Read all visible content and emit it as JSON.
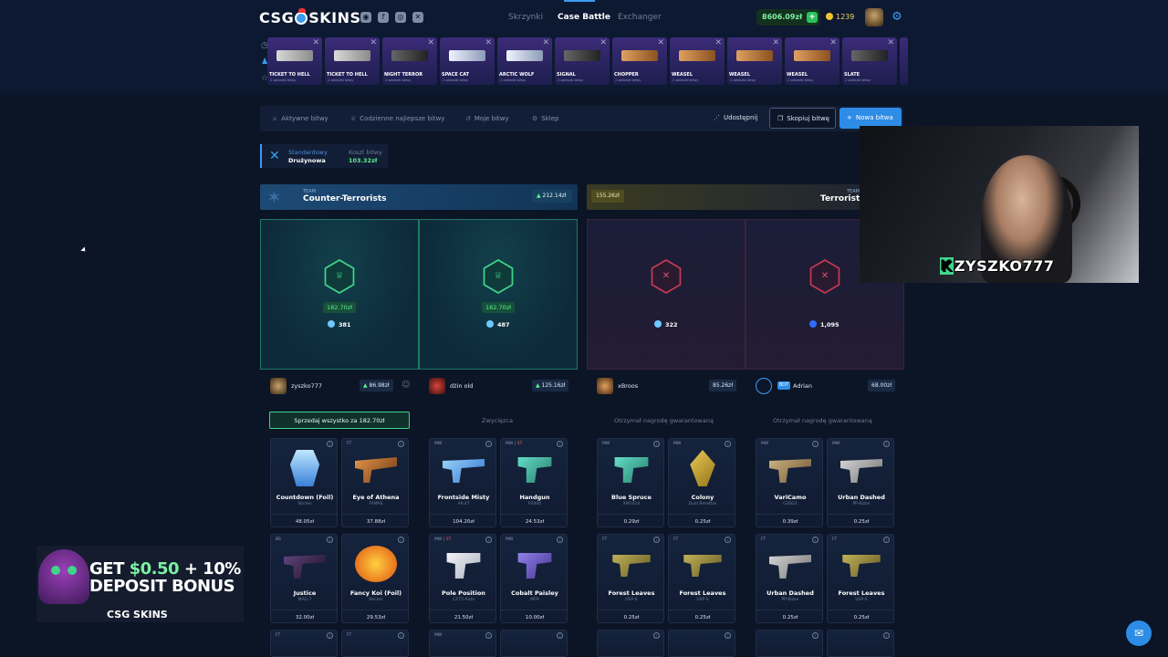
{
  "header": {
    "logo": "CSG",
    "logo_suffix": "SKINS",
    "nav": [
      "Skrzynki",
      "Case Battle",
      "Exchanger"
    ],
    "balance": "8606.09zł",
    "coins": "1239"
  },
  "drops": [
    {
      "name": "TICKET TO HELL",
      "sub": "2 zakładki bitwy"
    },
    {
      "name": "TICKET TO HELL",
      "sub": "2 zakładki bitwy"
    },
    {
      "name": "NIGHT TERROR",
      "sub": "2 zakładki bitwy"
    },
    {
      "name": "SPACE CAT",
      "sub": "2 zakładki bitwy"
    },
    {
      "name": "ARCTIC WOLF",
      "sub": "2 zakładki bitwy"
    },
    {
      "name": "SIGNAL",
      "sub": "2 zakładki bitwy"
    },
    {
      "name": "CHOPPER",
      "sub": "2 zakładki bitwy"
    },
    {
      "name": "WEASEL",
      "sub": "2 zakładki bitwy"
    },
    {
      "name": "WEASEL",
      "sub": "2 zakładki bitwy"
    },
    {
      "name": "WEASEL",
      "sub": "2 zakładki bitwy"
    },
    {
      "name": "SLATE",
      "sub": "2 zakładki bitwy"
    }
  ],
  "battlebar": {
    "tabs": [
      "Aktywne bitwy",
      "Codzienne najlepsze bitwy",
      "Moje bitwy",
      "Sklep"
    ],
    "share": "Udostępnij",
    "copy": "Skopiuj bitwę",
    "new": "Nowa bitwa"
  },
  "battle_type": {
    "mode_label": "Standardowy",
    "mode_value": "Drużynowa",
    "cost_label": "Koszt bitwy",
    "cost_value": "103.32zł"
  },
  "teams": {
    "ct": {
      "tag": "TEAM",
      "name": "Counter-Terrorists",
      "value": "212.14zł"
    },
    "t": {
      "tag": "TEAM",
      "name": "Terrorists",
      "value": "155.26zł"
    }
  },
  "panels": [
    {
      "prize": "182.70zł",
      "gems": "381"
    },
    {
      "prize": "182.70zł",
      "gems": "487"
    },
    {
      "gems": "322"
    },
    {
      "gems": "1,095"
    }
  ],
  "players": [
    {
      "name": "zyszko777",
      "value": "86.98zł"
    },
    {
      "name": "dżin old",
      "value": "125.16zł"
    },
    {
      "name": "xBroos",
      "value": "85.26zł"
    },
    {
      "name": "Adrian",
      "value": "68.00zł",
      "badge": "BOT"
    }
  ],
  "actions": {
    "sell": "Sprzedaj wszystko za 182.70zł",
    "won": "Zwycięzca",
    "guaranteed": "Otrzymał nagrodę gwarantowaną"
  },
  "cards_row1": [
    {
      "wear": "",
      "name": "Countdown (Foil)",
      "sub": "Sticker",
      "price": "48.05zł",
      "art": "sticker"
    },
    {
      "wear": "FT",
      "name": "Eye of Athena",
      "sub": "FAMAS",
      "price": "37.88zł",
      "art": "orange"
    },
    {
      "wear": "MW",
      "name": "Frontside Misty",
      "sub": "AK-47",
      "price": "104.20zł",
      "art": "blue"
    },
    {
      "wear": "MW | ST",
      "name": "Handgun",
      "sub": "P2000",
      "price": "24.53zł",
      "art": "teal"
    },
    {
      "wear": "MW",
      "name": "Blue Spruce",
      "sub": "XM1014",
      "price": "0.29zł",
      "art": "teal"
    },
    {
      "wear": "MW",
      "name": "Colony",
      "sub": "Dual Berettas",
      "price": "0.25zł",
      "art": "gold"
    },
    {
      "wear": "MW",
      "name": "VariCamo",
      "sub": "G3SG1",
      "price": "0.39zł",
      "art": "tan"
    },
    {
      "wear": "MW",
      "name": "Urban Dashed",
      "sub": "PP-Bizon",
      "price": "0.25zł",
      "art": "grey"
    }
  ],
  "cards_row2": [
    {
      "wear": "BS",
      "name": "Justice",
      "sub": "MAG-7",
      "price": "32.00zł",
      "art": "dark"
    },
    {
      "wear": "",
      "name": "Fancy Koi (Foil)",
      "sub": "Sticker",
      "price": "29.53zł",
      "art": "koi"
    },
    {
      "wear": "MW | ST",
      "name": "Pole Position",
      "sub": "CZ75-Auto",
      "price": "21.50zł",
      "art": "white"
    },
    {
      "wear": "MW",
      "name": "Cobalt Paisley",
      "sub": "MP9",
      "price": "10.00zł",
      "art": "purple"
    },
    {
      "wear": "FT",
      "name": "Forest Leaves",
      "sub": "USP-S",
      "price": "0.25zł",
      "art": "olive"
    },
    {
      "wear": "FT",
      "name": "Forest Leaves",
      "sub": "USP-S",
      "price": "0.25zł",
      "art": "olive"
    },
    {
      "wear": "FT",
      "name": "Urban Dashed",
      "sub": "PP-Bizon",
      "price": "0.25zł",
      "art": "grey"
    },
    {
      "wear": "FT",
      "name": "Forest Leaves",
      "sub": "USP-S",
      "price": "0.25zł",
      "art": "olive"
    }
  ],
  "cards_row3_wear": [
    "FT",
    "FT",
    "MW",
    "",
    "",
    "",
    "",
    ""
  ],
  "ad": {
    "line1_prefix": "GET ",
    "line1_amount": "$0.50",
    "line1_suffix": " + 10%",
    "line2": "DEPOSIT BONUS",
    "logo": "CSG SKINS"
  },
  "webcam": {
    "label_k": "K",
    "label": "ZYSZKO777"
  },
  "colors": {
    "accent": "#2d8de6",
    "win": "#3fd68a",
    "lose": "#c43a52"
  }
}
